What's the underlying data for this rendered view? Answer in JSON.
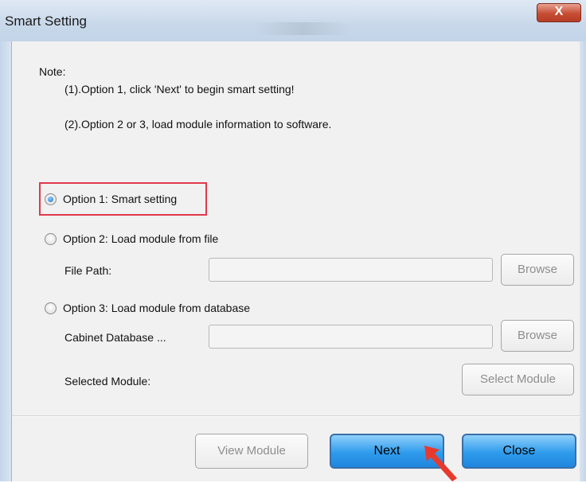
{
  "window": {
    "title": "Smart Setting",
    "close_label": "X"
  },
  "note": {
    "label": "Note:",
    "line1": "(1).Option 1, click 'Next' to begin smart setting!",
    "line2": "(2).Option 2 or 3, load module information to software."
  },
  "options": {
    "option1": {
      "label": "Option 1: Smart setting",
      "checked": true
    },
    "option2": {
      "label": "Option 2: Load module from file",
      "checked": false
    },
    "option3": {
      "label": "Option 3: Load module from database",
      "checked": false
    }
  },
  "fields": {
    "file_path_label": "File Path:",
    "file_path_value": "",
    "cabinet_db_label": "Cabinet Database ...",
    "cabinet_db_value": "",
    "selected_module_label": "Selected Module:"
  },
  "buttons": {
    "browse1": "Browse",
    "browse2": "Browse",
    "select_module": "Select Module",
    "view_module": "View Module",
    "next": "Next",
    "close": "Close"
  },
  "colors": {
    "highlight_box": "#e0394a",
    "arrow": "#e8392f",
    "primary_button": "#2f9bec"
  }
}
